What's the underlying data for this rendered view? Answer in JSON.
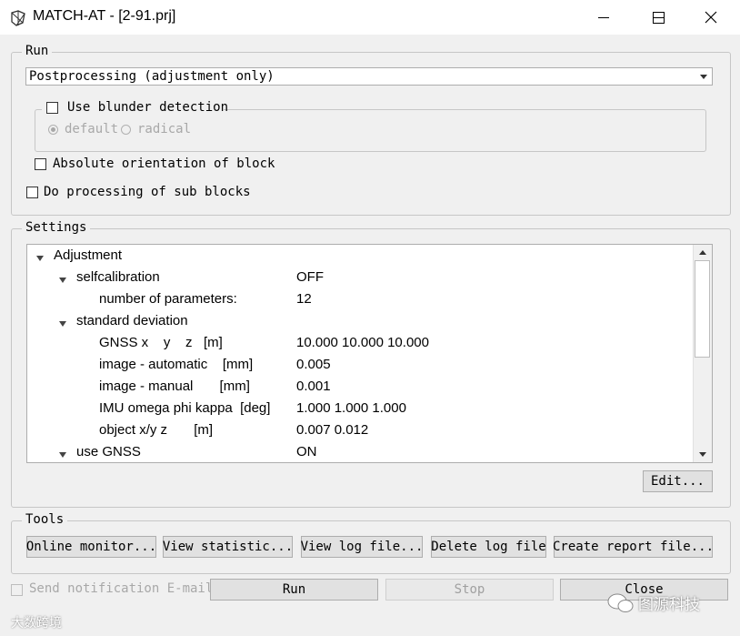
{
  "window": {
    "title": "MATCH-AT - [2-91.prj]"
  },
  "run": {
    "label": "Run",
    "mode": "Postprocessing (adjustment only)",
    "use_blunder_detection": "Use blunder detection",
    "option_default": "default",
    "option_radical": "radical",
    "absolute_orientation": "Absolute orientation of block",
    "sub_blocks": "Do processing of sub blocks"
  },
  "settings": {
    "label": "Settings",
    "rows": [
      {
        "name": "Adjustment",
        "value": ""
      },
      {
        "name": "selfcalibration",
        "value": "OFF"
      },
      {
        "name": "number of parameters:",
        "value": "12"
      },
      {
        "name": "standard deviation",
        "value": ""
      },
      {
        "name": "GNSS x    y    z   [m]",
        "value": "10.000 10.000 10.000"
      },
      {
        "name": "image - automatic    [mm]",
        "value": "0.005"
      },
      {
        "name": "image - manual       [mm]",
        "value": "0.001"
      },
      {
        "name": "IMU omega phi kappa  [deg]",
        "value": "1.000 1.000 1.000"
      },
      {
        "name": "object x/y z       [m]",
        "value": "0.007 0.012"
      },
      {
        "name": "use GNSS",
        "value": "ON"
      }
    ],
    "edit_button": "Edit..."
  },
  "tools": {
    "label": "Tools",
    "online_monitor": "Online monitor...",
    "view_statistic": "View statistic...",
    "view_log": "View log file...",
    "delete_log": "Delete log file",
    "create_report": "Create report file..."
  },
  "footer": {
    "send_email": "Send notification E-mail",
    "run": "Run",
    "stop": "Stop",
    "close": "Close"
  },
  "watermarks": {
    "left": "大数跨境",
    "right": "图源科技"
  }
}
